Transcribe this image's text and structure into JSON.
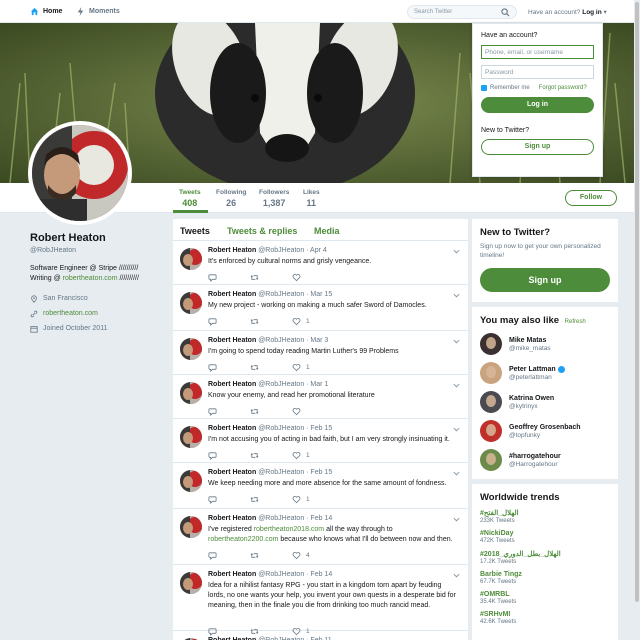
{
  "topnav": {
    "home": "Home",
    "moments": "Moments",
    "search_placeholder": "Search Twitter",
    "have_account": "Have an account?",
    "login": "Log in"
  },
  "login_card": {
    "heading": "Have an account?",
    "username_placeholder": "Phone, email, or username",
    "password_placeholder": "Password",
    "remember": "Remember me",
    "forgot": "Forgot password?",
    "login_button": "Log in",
    "new_heading": "New to Twitter?",
    "signup_button": "Sign up"
  },
  "profile_nav": {
    "stats": [
      {
        "label": "Tweets",
        "value": "408"
      },
      {
        "label": "Following",
        "value": "26"
      },
      {
        "label": "Followers",
        "value": "1,387"
      },
      {
        "label": "Likes",
        "value": "11"
      }
    ],
    "follow_button": "Follow"
  },
  "profile": {
    "name": "Robert Heaton",
    "handle": "@RobJHeaton",
    "bio_line1": "Software Engineer @ Stripe //////////",
    "bio_line2_prefix": "Writing @ ",
    "bio_link": "robertheaton.com",
    "bio_line2_suffix": " //////////",
    "location": "San Francisco",
    "website": "robertheaton.com",
    "joined": "Joined October 2011"
  },
  "timeline": {
    "tabs": [
      "Tweets",
      "Tweets & replies",
      "Media"
    ],
    "tweets": [
      {
        "name": "Robert Heaton",
        "meta": "@RobJHeaton · Apr 4",
        "text": "It's enforced by cultural norms and grisly vengeance.",
        "likes": ""
      },
      {
        "name": "Robert Heaton",
        "meta": "@RobJHeaton · Mar 15",
        "text": "My new project - working on making a much safer Sword of Damocles.",
        "likes": "1"
      },
      {
        "name": "Robert Heaton",
        "meta": "@RobJHeaton · Mar 3",
        "text": "I'm going to spend today reading Martin Luther's 99 Problems",
        "likes": "1"
      },
      {
        "name": "Robert Heaton",
        "meta": "@RobJHeaton · Mar 1",
        "text": "Know your enemy, and read her promotional literature",
        "likes": ""
      },
      {
        "name": "Robert Heaton",
        "meta": "@RobJHeaton · Feb 15",
        "text": "I'm not accusing you of acting in bad faith, but I am very strongly insinuating it.",
        "likes": "1"
      },
      {
        "name": "Robert Heaton",
        "meta": "@RobJHeaton · Feb 15",
        "text": "We keep needing more and more absence for the same amount of fondness.",
        "likes": "1"
      },
      {
        "name": "Robert Heaton",
        "meta": "@RobJHeaton · Feb 14",
        "text_before": "I've registered ",
        "link1": "robertheaton2018.com",
        "text_mid": " all the way through to ",
        "link2": "robertheaton2200.com",
        "text_after": " because who knows what I'll do between now and then.",
        "likes": "4"
      },
      {
        "name": "Robert Heaton",
        "meta": "@RobJHeaton · Feb 14",
        "text": "Idea for a nihilist fantasy RPG - you start in a kingdom torn apart by feuding lords, no one wants your help, you invent your own quests in a desperate bid for meaning, then in the finale you die from drinking too much rancid mead.",
        "likes": "1"
      },
      {
        "name": "Robert Heaton",
        "meta": "@RobJHeaton · Feb 11",
        "text": "",
        "likes": ""
      }
    ]
  },
  "new_to_twitter": {
    "title": "New to Twitter?",
    "sub": "Sign up now to get your own personalized timeline!",
    "button": "Sign up"
  },
  "may_like": {
    "title": "You may also like",
    "refresh": "· Refresh",
    "people": [
      {
        "name": "Mike Matas",
        "handle": "@mike_matas",
        "verified": false,
        "color": "#3a3030"
      },
      {
        "name": "Peter Lattman",
        "handle": "@peterlattman",
        "verified": true,
        "color": "#c9a37d"
      },
      {
        "name": "Katrina Owen",
        "handle": "@kytrinyx",
        "verified": false,
        "color": "#4a4a50"
      },
      {
        "name": "Geoffrey Grosenbach",
        "handle": "@topfunky",
        "verified": false,
        "color": "#c0302a"
      },
      {
        "name": "#harrogatehour",
        "handle": "@Harrogatehour",
        "verified": false,
        "color": "#6c8a4a"
      }
    ]
  },
  "trends": {
    "title": "Worldwide trends",
    "items": [
      {
        "name": "#الهلال_الفتح",
        "count": "233K Tweets"
      },
      {
        "name": "#NickiDay",
        "count": "472K Tweets"
      },
      {
        "name": "#الهلال_بطل_الدوري_2018",
        "count": "17.2K Tweets"
      },
      {
        "name": "Barbie Tingz",
        "count": "67.7K Tweets"
      },
      {
        "name": "#OMRBL",
        "count": "35.4K Tweets"
      },
      {
        "name": "#SRHvMI",
        "count": "42.6K Tweets"
      }
    ]
  },
  "colors": {
    "accent": "#4d8c3a",
    "blue": "#1da1f2"
  }
}
